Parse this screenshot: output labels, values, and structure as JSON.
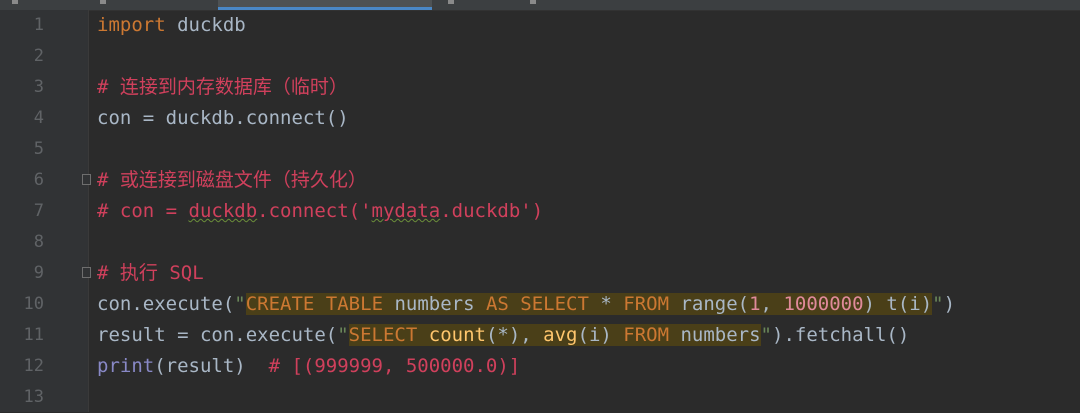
{
  "lines": [
    {
      "n": "1",
      "parts": [
        [
          "kw",
          "import"
        ],
        [
          "p",
          " duckdb"
        ]
      ]
    },
    {
      "n": "2",
      "parts": []
    },
    {
      "n": "3",
      "parts": [
        [
          "cm",
          "# 连接到内存数据库（临时）"
        ]
      ]
    },
    {
      "n": "4",
      "parts": [
        [
          "p",
          "con = duckdb.connect()"
        ]
      ]
    },
    {
      "n": "5",
      "parts": []
    },
    {
      "n": "6",
      "parts": [
        [
          "cm",
          "# 或连接到磁盘文件（持久化）"
        ]
      ]
    },
    {
      "n": "7",
      "parts": [
        [
          "cm",
          "# con = "
        ],
        [
          "cmsq",
          "duckdb"
        ],
        [
          "cm",
          ".connect('"
        ],
        [
          "cmsq",
          "mydata"
        ],
        [
          "cm",
          ".duckdb')"
        ]
      ]
    },
    {
      "n": "8",
      "parts": []
    },
    {
      "n": "9",
      "parts": [
        [
          "cm",
          "# 执行 SQL"
        ]
      ]
    },
    {
      "n": "10",
      "parts": [
        [
          "p",
          "con.execute("
        ],
        [
          "str",
          "\""
        ],
        [
          "hsql",
          "CREATE TABLE"
        ],
        [
          "hp",
          " numbers "
        ],
        [
          "hsql",
          "AS SELECT"
        ],
        [
          "hp",
          " * "
        ],
        [
          "hsql",
          "FROM"
        ],
        [
          "hp",
          " range("
        ],
        [
          "hnum",
          "1"
        ],
        [
          "hp",
          ", "
        ],
        [
          "hnum",
          "1000000"
        ],
        [
          "hp",
          ") t(i)"
        ],
        [
          "str",
          "\""
        ],
        [
          "p",
          ")"
        ]
      ]
    },
    {
      "n": "11",
      "parts": [
        [
          "p",
          "result = con.execute("
        ],
        [
          "str",
          "\""
        ],
        [
          "hsql",
          "SELECT"
        ],
        [
          "hp",
          " "
        ],
        [
          "hfn",
          "count"
        ],
        [
          "hp",
          "(*), "
        ],
        [
          "hfn",
          "avg"
        ],
        [
          "hp",
          "(i) "
        ],
        [
          "hsql",
          "FROM"
        ],
        [
          "hp",
          " numbers"
        ],
        [
          "str",
          "\""
        ],
        [
          "p",
          ").fetchall()"
        ]
      ]
    },
    {
      "n": "12",
      "parts": [
        [
          "builtin",
          "print"
        ],
        [
          "p",
          "(result)  "
        ],
        [
          "cm",
          "# [(999999, 500000.0)]"
        ]
      ]
    },
    {
      "n": "13",
      "parts": []
    }
  ]
}
